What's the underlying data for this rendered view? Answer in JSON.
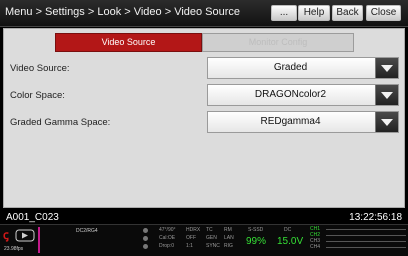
{
  "header": {
    "breadcrumb": "Menu > Settings > Look > Video > Video Source",
    "buttons": {
      "more": "...",
      "help": "Help",
      "back": "Back",
      "close": "Close"
    }
  },
  "tabs": [
    {
      "label": "Video Source",
      "active": true
    },
    {
      "label": "Monitor Config",
      "active": false
    }
  ],
  "settings": [
    {
      "label": "Video Source:",
      "value": "Graded"
    },
    {
      "label": "Color Space:",
      "value": "DRAGONcolor2"
    },
    {
      "label": "Graded Gamma Space:",
      "value": "REDgamma4"
    }
  ],
  "clip_name": "A001_C023",
  "timecode": "13:22:56:18",
  "status": {
    "fps": "23.98fps",
    "codec": "DC2/RG4",
    "shutter": "47°/90°",
    "cal": "Cal:OE",
    "drop": "Drop:0",
    "col1": [
      "HDRX",
      "OFF",
      "1:1"
    ],
    "col2": [
      "TC",
      "GEN",
      "SYNC"
    ],
    "col3": [
      "RM",
      "LAN",
      "RIG"
    ],
    "storage_label": "S-SSD",
    "storage_value": "99%",
    "power_label": "DC",
    "power_value": "15.0V",
    "channels": [
      "CH1",
      "CH2",
      "CH3",
      "CH4"
    ]
  },
  "colors": {
    "accent_red": "#b31717",
    "status_green": "#35e035"
  }
}
